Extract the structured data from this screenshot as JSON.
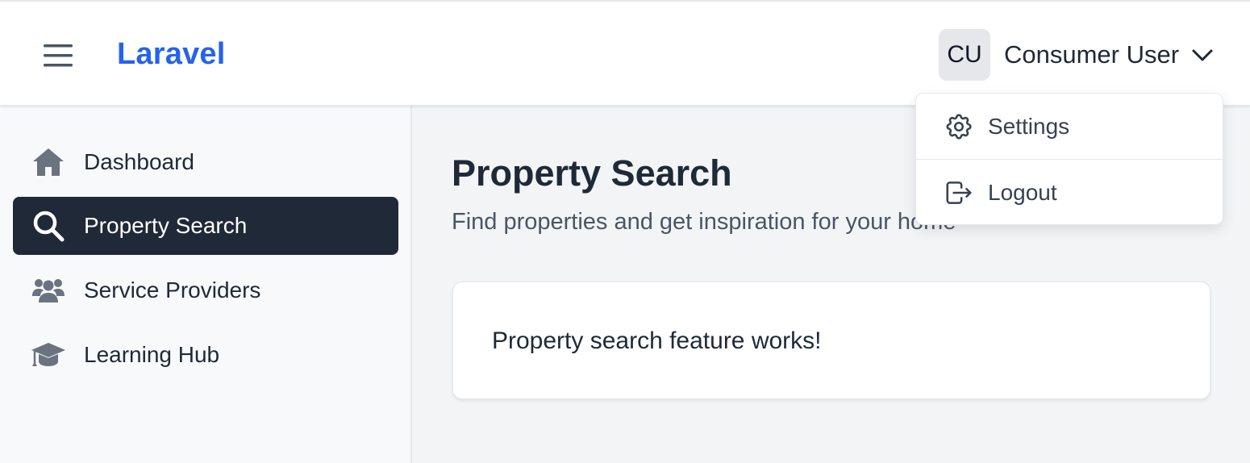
{
  "header": {
    "brand": "Laravel",
    "menu_icon": "hamburger-icon",
    "user": {
      "initials": "CU",
      "name": "Consumer User",
      "chevron_icon": "chevron-down-icon"
    }
  },
  "user_dropdown": {
    "items": [
      {
        "label": "Settings",
        "icon": "gear-icon"
      },
      {
        "label": "Logout",
        "icon": "logout-icon"
      }
    ]
  },
  "sidebar": {
    "items": [
      {
        "label": "Dashboard",
        "icon": "home-icon",
        "active": false
      },
      {
        "label": "Property Search",
        "icon": "search-icon",
        "active": true
      },
      {
        "label": "Service Providers",
        "icon": "users-icon",
        "active": false
      },
      {
        "label": "Learning Hub",
        "icon": "graduation-cap-icon",
        "active": false
      }
    ]
  },
  "main": {
    "title": "Property Search",
    "subtitle": "Find properties and get inspiration for your home",
    "card_text": "Property search feature works!"
  },
  "colors": {
    "brand": "#2563eb",
    "active_nav_bg": "#1f2937",
    "page_bg": "#f3f4f6"
  }
}
